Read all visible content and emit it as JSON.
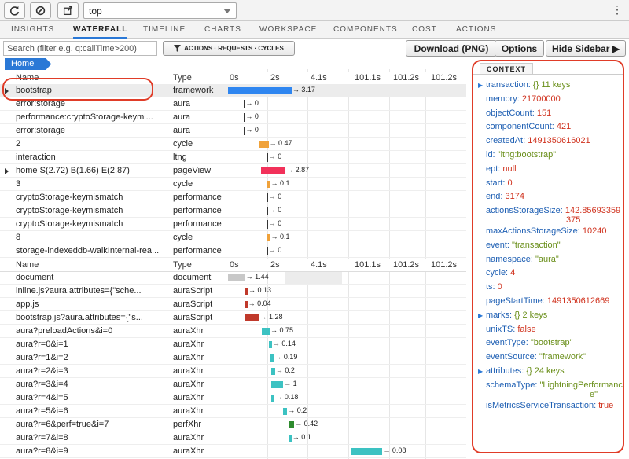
{
  "toolbar": {
    "refresh_icon": "refresh-icon",
    "clear_icon": "block-icon",
    "popout_icon": "external-link-icon",
    "context_select_value": "top",
    "menu_glyph": "⋮"
  },
  "tabs": [
    {
      "label": "INSIGHTS",
      "active": false
    },
    {
      "label": "WATERFALL",
      "active": true
    },
    {
      "label": "TIMELINE",
      "active": false
    },
    {
      "label": "CHARTS",
      "active": false
    },
    {
      "label": "WORKSPACE",
      "active": false
    },
    {
      "label": "COMPONENTS",
      "active": false
    },
    {
      "label": "COST",
      "active": false
    },
    {
      "label": "ACTIONS",
      "active": false
    }
  ],
  "actionbar": {
    "search_placeholder": "Search (filter e.g. q:callTime>200)",
    "filter_label": "ACTIONS · REQUESTS · CYCLES",
    "download_label": "Download (PNG)",
    "options_label": "Options",
    "hide_sidebar_label": "Hide Sidebar ▶"
  },
  "breadcrumb": "Home",
  "colors": {
    "accent": "#2a78d6",
    "highlight": "#e03c28",
    "framework": "#2f86f0",
    "cycle": "#f0a23a",
    "pageView": "#f2315a",
    "document": "#c8c8c8",
    "auraScript": "#c0392b",
    "auraXhr": "#3cc2c2",
    "perfXhr": "#2e8b2e"
  },
  "timeline_headers": [
    "0s",
    "2s",
    "4.1s",
    "101.1s",
    "101.2s",
    "101.2s"
  ],
  "actions_table": {
    "col_name": "Name",
    "col_type": "Type",
    "rows": [
      {
        "name": "bootstrap",
        "type": "framework",
        "dur": "3.17",
        "start": 0,
        "len": 3.17,
        "color": "#2f86f0",
        "expandable": true,
        "selected": true
      },
      {
        "name": "error:storage",
        "type": "aura",
        "dur": "0",
        "start": 0.8,
        "len": 0,
        "color": "",
        "expandable": false
      },
      {
        "name": "performance:cryptoStorage-keymi...",
        "type": "aura",
        "dur": "0",
        "start": 0.8,
        "len": 0,
        "color": "",
        "expandable": false
      },
      {
        "name": "error:storage",
        "type": "aura",
        "dur": "0",
        "start": 0.8,
        "len": 0,
        "color": "",
        "expandable": false
      },
      {
        "name": "2",
        "type": "cycle",
        "dur": "0.47",
        "start": 1.55,
        "len": 0.47,
        "color": "#f0a23a",
        "expandable": false
      },
      {
        "name": "interaction",
        "type": "ltng",
        "dur": "0",
        "start": 1.95,
        "len": 0,
        "color": "",
        "expandable": false
      },
      {
        "name": "home S(2.72) B(1.66) E(2.87)",
        "type": "pageView",
        "dur": "2.87",
        "start": 1.66,
        "len": 1.21,
        "color": "#f2315a",
        "expandable": true
      },
      {
        "name": "3",
        "type": "cycle",
        "dur": "0.1",
        "start": 1.98,
        "len": 0.1,
        "color": "#f0a23a",
        "expandable": false
      },
      {
        "name": "cryptoStorage-keymismatch",
        "type": "performance",
        "dur": "0",
        "start": 1.95,
        "len": 0,
        "color": "",
        "expandable": false
      },
      {
        "name": "cryptoStorage-keymismatch",
        "type": "performance",
        "dur": "0",
        "start": 1.95,
        "len": 0,
        "color": "",
        "expandable": false
      },
      {
        "name": "cryptoStorage-keymismatch",
        "type": "performance",
        "dur": "0",
        "start": 1.95,
        "len": 0,
        "color": "",
        "expandable": false
      },
      {
        "name": "8",
        "type": "cycle",
        "dur": "0.1",
        "start": 1.98,
        "len": 0.1,
        "color": "#f0a23a",
        "expandable": false
      },
      {
        "name": "storage-indexeddb-walkInternal-rea...",
        "type": "performance",
        "dur": "0",
        "start": 1.95,
        "len": 0,
        "color": "",
        "expandable": false
      }
    ]
  },
  "requests_table": {
    "col_name": "Name",
    "col_type": "Type",
    "rows": [
      {
        "name": "document",
        "type": "document",
        "dur": "1.44",
        "start": 0,
        "len": 0.85,
        "color": "#c8c8c8"
      },
      {
        "name": "inline.js?aura.attributes={\"sche...",
        "type": "auraScript",
        "dur": "0.13",
        "start": 0.85,
        "len": 0.13,
        "color": "#c0392b"
      },
      {
        "name": "app.js",
        "type": "auraScript",
        "dur": "0.04",
        "start": 0.85,
        "len": 0.04,
        "color": "#c0392b"
      },
      {
        "name": "bootstrap.js?aura.attributes={\"s...",
        "type": "auraScript",
        "dur": "1.28",
        "start": 0.85,
        "len": 0.7,
        "color": "#c0392b"
      },
      {
        "name": "aura?preloadActions&i=0",
        "type": "auraXhr",
        "dur": "0.75",
        "start": 1.68,
        "len": 0.4,
        "color": "#3cc2c2"
      },
      {
        "name": "aura?r=0&i=1",
        "type": "auraXhr",
        "dur": "0.14",
        "start": 2.05,
        "len": 0.14,
        "color": "#3cc2c2"
      },
      {
        "name": "aura?r=1&i=2",
        "type": "auraXhr",
        "dur": "0.19",
        "start": 2.1,
        "len": 0.19,
        "color": "#3cc2c2"
      },
      {
        "name": "aura?r=2&i=3",
        "type": "auraXhr",
        "dur": "0.2",
        "start": 2.15,
        "len": 0.2,
        "color": "#3cc2c2"
      },
      {
        "name": "aura?r=3&i=4",
        "type": "auraXhr",
        "dur": "1",
        "start": 2.15,
        "len": 0.6,
        "color": "#3cc2c2"
      },
      {
        "name": "aura?r=4&i=5",
        "type": "auraXhr",
        "dur": "0.18",
        "start": 2.15,
        "len": 0.18,
        "color": "#3cc2c2"
      },
      {
        "name": "aura?r=5&i=6",
        "type": "auraXhr",
        "dur": "0.2",
        "start": 2.75,
        "len": 0.2,
        "color": "#3cc2c2"
      },
      {
        "name": "aura?r=6&perf=true&i=7",
        "type": "perfXhr",
        "dur": "0.42",
        "start": 3.05,
        "len": 0.25,
        "color": "#2e8b2e"
      },
      {
        "name": "aura?r=7&i=8",
        "type": "auraXhr",
        "dur": "0.1",
        "start": 3.05,
        "len": 0.1,
        "color": "#3cc2c2"
      },
      {
        "name": "aura?r=8&i=9",
        "type": "auraXhr",
        "dur": "0.08",
        "start": 6.1,
        "len": 1.6,
        "color": "#3cc2c2"
      }
    ]
  },
  "context": {
    "title": "CONTEXT",
    "entries": [
      {
        "key": "transaction:",
        "value": "{}  11 keys",
        "kind": "o",
        "caret": true
      },
      {
        "key": "memory:",
        "value": "21700000",
        "kind": "n"
      },
      {
        "key": "objectCount:",
        "value": "151",
        "kind": "n"
      },
      {
        "key": "componentCount:",
        "value": "421",
        "kind": "n"
      },
      {
        "key": "createdAt:",
        "value": "1491350616021",
        "kind": "n"
      },
      {
        "key": "id:",
        "value": "\"ltng:bootstrap\"",
        "kind": "s"
      },
      {
        "key": "ept:",
        "value": "null",
        "kind": "n"
      },
      {
        "key": "start:",
        "value": "0",
        "kind": "n"
      },
      {
        "key": "end:",
        "value": "3174",
        "kind": "n"
      },
      {
        "key": "actionsStorageSize:",
        "value": "142.85693359",
        "kind": "n",
        "cont": "375"
      },
      {
        "key": "maxActionsStorageSize:",
        "value": "10240",
        "kind": "n"
      },
      {
        "key": "event:",
        "value": "\"transaction\"",
        "kind": "s"
      },
      {
        "key": "namespace:",
        "value": "\"aura\"",
        "kind": "s"
      },
      {
        "key": "cycle:",
        "value": "4",
        "kind": "n"
      },
      {
        "key": "ts:",
        "value": "0",
        "kind": "n"
      },
      {
        "key": "pageStartTime:",
        "value": "1491350612669",
        "kind": "n"
      },
      {
        "key": "marks:",
        "value": "{}  2 keys",
        "kind": "o",
        "caret": true
      },
      {
        "key": "unixTS:",
        "value": "false",
        "kind": "n"
      },
      {
        "key": "eventType:",
        "value": "\"bootstrap\"",
        "kind": "s"
      },
      {
        "key": "eventSource:",
        "value": "\"framework\"",
        "kind": "s"
      },
      {
        "key": "attributes:",
        "value": "{}  24 keys",
        "kind": "o",
        "caret": true
      },
      {
        "key": "schemaType:",
        "value": "\"LightningPerformanc",
        "kind": "s",
        "cont": "e\""
      },
      {
        "key": "isMetricsServiceTransaction:",
        "value": "true",
        "kind": "n"
      }
    ]
  }
}
